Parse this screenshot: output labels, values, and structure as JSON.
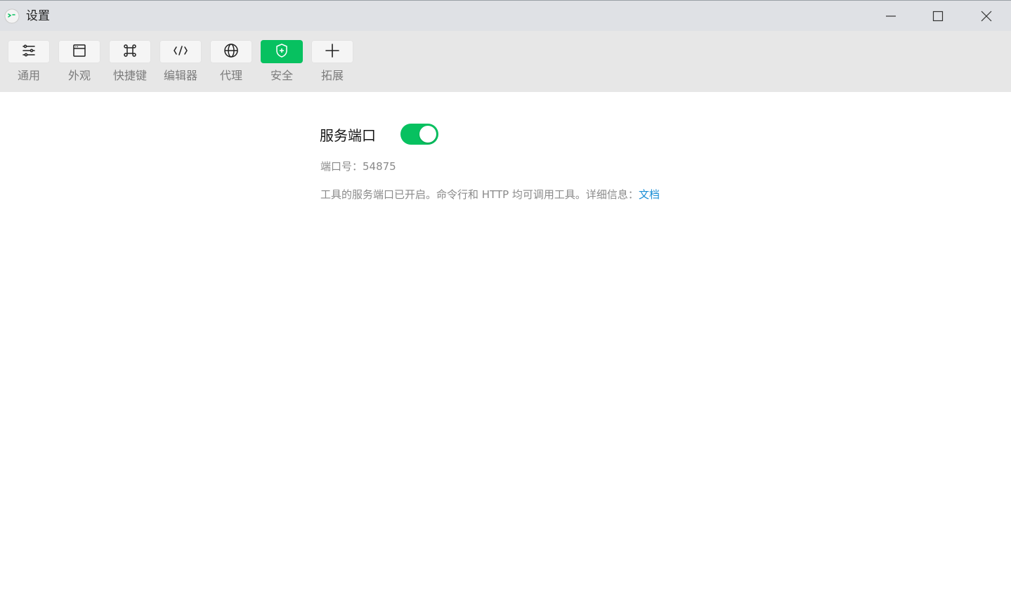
{
  "window": {
    "title": "设置",
    "icon": "app-logo-icon",
    "controls": [
      "minimize-icon",
      "maximize-icon",
      "close-icon"
    ]
  },
  "toolbar": {
    "items": [
      {
        "label": "通用",
        "icon": "sliders-icon",
        "active": false
      },
      {
        "label": "外观",
        "icon": "window-icon",
        "active": false
      },
      {
        "label": "快捷键",
        "icon": "command-key-icon",
        "active": false
      },
      {
        "label": "编辑器",
        "icon": "code-icon",
        "active": false
      },
      {
        "label": "代理",
        "icon": "globe-icon",
        "active": false
      },
      {
        "label": "安全",
        "icon": "shield-icon",
        "active": true
      },
      {
        "label": "拓展",
        "icon": "plus-icon",
        "active": false
      }
    ]
  },
  "settings": {
    "service_port": {
      "title": "服务端口",
      "enabled": true,
      "port_label": "端口号：54875",
      "description": "工具的服务端口已开启。命令行和 HTTP 均可调用工具。详细信息：",
      "link_text": "文档"
    }
  },
  "colors": {
    "accent": "#07c160",
    "link": "#1a8fd6",
    "titlebar": "#dfe1e5",
    "toolbar": "#e7e7e7"
  }
}
